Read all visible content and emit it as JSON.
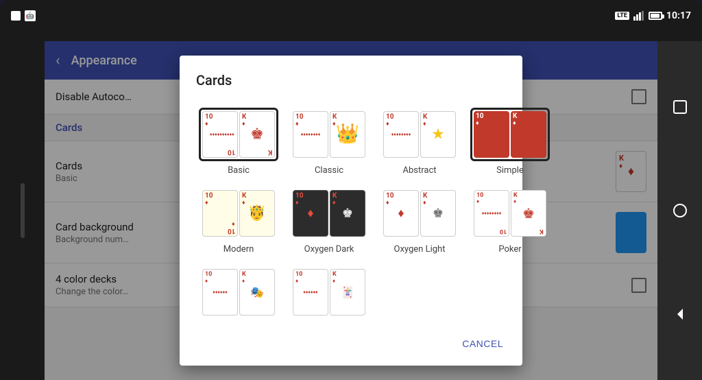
{
  "status_bar": {
    "time": "10:17",
    "lte": "LTE",
    "battery_icon": "battery"
  },
  "toolbar": {
    "back_label": "←",
    "title": "Appearance"
  },
  "settings": {
    "items": [
      {
        "id": "disable-autocomplete",
        "title": "Disable Autoco…",
        "subtitle": null,
        "has_checkbox": true
      },
      {
        "id": "cards-section-header",
        "title": "Cards",
        "subtitle": null,
        "is_header": true
      },
      {
        "id": "cards",
        "title": "Cards",
        "subtitle": "Basic",
        "has_card_preview": true
      },
      {
        "id": "card-background",
        "title": "Card background",
        "subtitle": "Background num…",
        "has_blue_card": true
      },
      {
        "id": "4-color-decks",
        "title": "4 color decks",
        "subtitle": "Change the color…",
        "has_checkbox": true
      }
    ]
  },
  "dialog": {
    "title": "Cards",
    "cancel_label": "CANCEL",
    "card_styles": [
      {
        "id": "basic",
        "label": "Basic",
        "selected": true
      },
      {
        "id": "classic",
        "label": "Classic",
        "selected": false
      },
      {
        "id": "abstract",
        "label": "Abstract",
        "selected": false
      },
      {
        "id": "simple",
        "label": "Simple",
        "selected": false
      },
      {
        "id": "modern",
        "label": "Modern",
        "selected": false
      },
      {
        "id": "oxygen-dark",
        "label": "Oxygen Dark",
        "selected": false
      },
      {
        "id": "oxygen-light",
        "label": "Oxygen Light",
        "selected": false
      },
      {
        "id": "poker",
        "label": "Poker",
        "selected": false
      },
      {
        "id": "row3-1",
        "label": "",
        "selected": false
      },
      {
        "id": "row3-2",
        "label": "",
        "selected": false
      }
    ]
  },
  "nav": {
    "square_label": "□",
    "circle_label": "○",
    "back_label": "◁"
  },
  "sidebar_text": "Cards Basic"
}
